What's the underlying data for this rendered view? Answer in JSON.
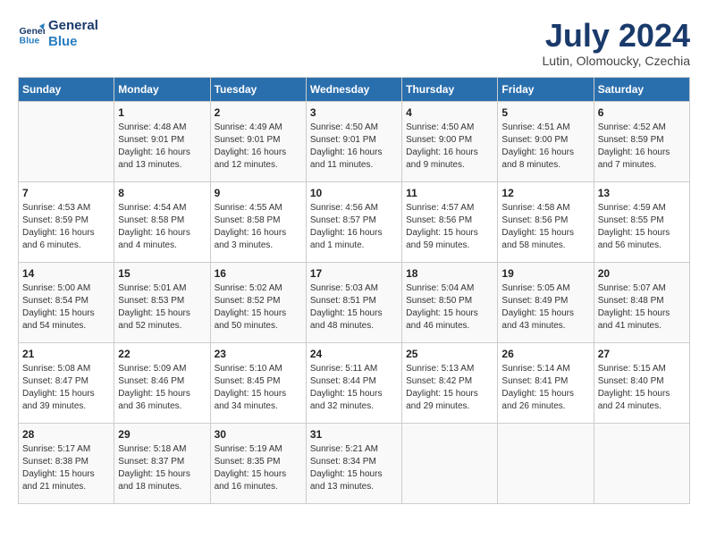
{
  "header": {
    "logo_line1": "General",
    "logo_line2": "Blue",
    "month_title": "July 2024",
    "location": "Lutin, Olomoucky, Czechia"
  },
  "days_of_week": [
    "Sunday",
    "Monday",
    "Tuesday",
    "Wednesday",
    "Thursday",
    "Friday",
    "Saturday"
  ],
  "weeks": [
    [
      {
        "day": "",
        "info": ""
      },
      {
        "day": "1",
        "info": "Sunrise: 4:48 AM\nSunset: 9:01 PM\nDaylight: 16 hours\nand 13 minutes."
      },
      {
        "day": "2",
        "info": "Sunrise: 4:49 AM\nSunset: 9:01 PM\nDaylight: 16 hours\nand 12 minutes."
      },
      {
        "day": "3",
        "info": "Sunrise: 4:50 AM\nSunset: 9:01 PM\nDaylight: 16 hours\nand 11 minutes."
      },
      {
        "day": "4",
        "info": "Sunrise: 4:50 AM\nSunset: 9:00 PM\nDaylight: 16 hours\nand 9 minutes."
      },
      {
        "day": "5",
        "info": "Sunrise: 4:51 AM\nSunset: 9:00 PM\nDaylight: 16 hours\nand 8 minutes."
      },
      {
        "day": "6",
        "info": "Sunrise: 4:52 AM\nSunset: 8:59 PM\nDaylight: 16 hours\nand 7 minutes."
      }
    ],
    [
      {
        "day": "7",
        "info": "Sunrise: 4:53 AM\nSunset: 8:59 PM\nDaylight: 16 hours\nand 6 minutes."
      },
      {
        "day": "8",
        "info": "Sunrise: 4:54 AM\nSunset: 8:58 PM\nDaylight: 16 hours\nand 4 minutes."
      },
      {
        "day": "9",
        "info": "Sunrise: 4:55 AM\nSunset: 8:58 PM\nDaylight: 16 hours\nand 3 minutes."
      },
      {
        "day": "10",
        "info": "Sunrise: 4:56 AM\nSunset: 8:57 PM\nDaylight: 16 hours\nand 1 minute."
      },
      {
        "day": "11",
        "info": "Sunrise: 4:57 AM\nSunset: 8:56 PM\nDaylight: 15 hours\nand 59 minutes."
      },
      {
        "day": "12",
        "info": "Sunrise: 4:58 AM\nSunset: 8:56 PM\nDaylight: 15 hours\nand 58 minutes."
      },
      {
        "day": "13",
        "info": "Sunrise: 4:59 AM\nSunset: 8:55 PM\nDaylight: 15 hours\nand 56 minutes."
      }
    ],
    [
      {
        "day": "14",
        "info": "Sunrise: 5:00 AM\nSunset: 8:54 PM\nDaylight: 15 hours\nand 54 minutes."
      },
      {
        "day": "15",
        "info": "Sunrise: 5:01 AM\nSunset: 8:53 PM\nDaylight: 15 hours\nand 52 minutes."
      },
      {
        "day": "16",
        "info": "Sunrise: 5:02 AM\nSunset: 8:52 PM\nDaylight: 15 hours\nand 50 minutes."
      },
      {
        "day": "17",
        "info": "Sunrise: 5:03 AM\nSunset: 8:51 PM\nDaylight: 15 hours\nand 48 minutes."
      },
      {
        "day": "18",
        "info": "Sunrise: 5:04 AM\nSunset: 8:50 PM\nDaylight: 15 hours\nand 46 minutes."
      },
      {
        "day": "19",
        "info": "Sunrise: 5:05 AM\nSunset: 8:49 PM\nDaylight: 15 hours\nand 43 minutes."
      },
      {
        "day": "20",
        "info": "Sunrise: 5:07 AM\nSunset: 8:48 PM\nDaylight: 15 hours\nand 41 minutes."
      }
    ],
    [
      {
        "day": "21",
        "info": "Sunrise: 5:08 AM\nSunset: 8:47 PM\nDaylight: 15 hours\nand 39 minutes."
      },
      {
        "day": "22",
        "info": "Sunrise: 5:09 AM\nSunset: 8:46 PM\nDaylight: 15 hours\nand 36 minutes."
      },
      {
        "day": "23",
        "info": "Sunrise: 5:10 AM\nSunset: 8:45 PM\nDaylight: 15 hours\nand 34 minutes."
      },
      {
        "day": "24",
        "info": "Sunrise: 5:11 AM\nSunset: 8:44 PM\nDaylight: 15 hours\nand 32 minutes."
      },
      {
        "day": "25",
        "info": "Sunrise: 5:13 AM\nSunset: 8:42 PM\nDaylight: 15 hours\nand 29 minutes."
      },
      {
        "day": "26",
        "info": "Sunrise: 5:14 AM\nSunset: 8:41 PM\nDaylight: 15 hours\nand 26 minutes."
      },
      {
        "day": "27",
        "info": "Sunrise: 5:15 AM\nSunset: 8:40 PM\nDaylight: 15 hours\nand 24 minutes."
      }
    ],
    [
      {
        "day": "28",
        "info": "Sunrise: 5:17 AM\nSunset: 8:38 PM\nDaylight: 15 hours\nand 21 minutes."
      },
      {
        "day": "29",
        "info": "Sunrise: 5:18 AM\nSunset: 8:37 PM\nDaylight: 15 hours\nand 18 minutes."
      },
      {
        "day": "30",
        "info": "Sunrise: 5:19 AM\nSunset: 8:35 PM\nDaylight: 15 hours\nand 16 minutes."
      },
      {
        "day": "31",
        "info": "Sunrise: 5:21 AM\nSunset: 8:34 PM\nDaylight: 15 hours\nand 13 minutes."
      },
      {
        "day": "",
        "info": ""
      },
      {
        "day": "",
        "info": ""
      },
      {
        "day": "",
        "info": ""
      }
    ]
  ]
}
